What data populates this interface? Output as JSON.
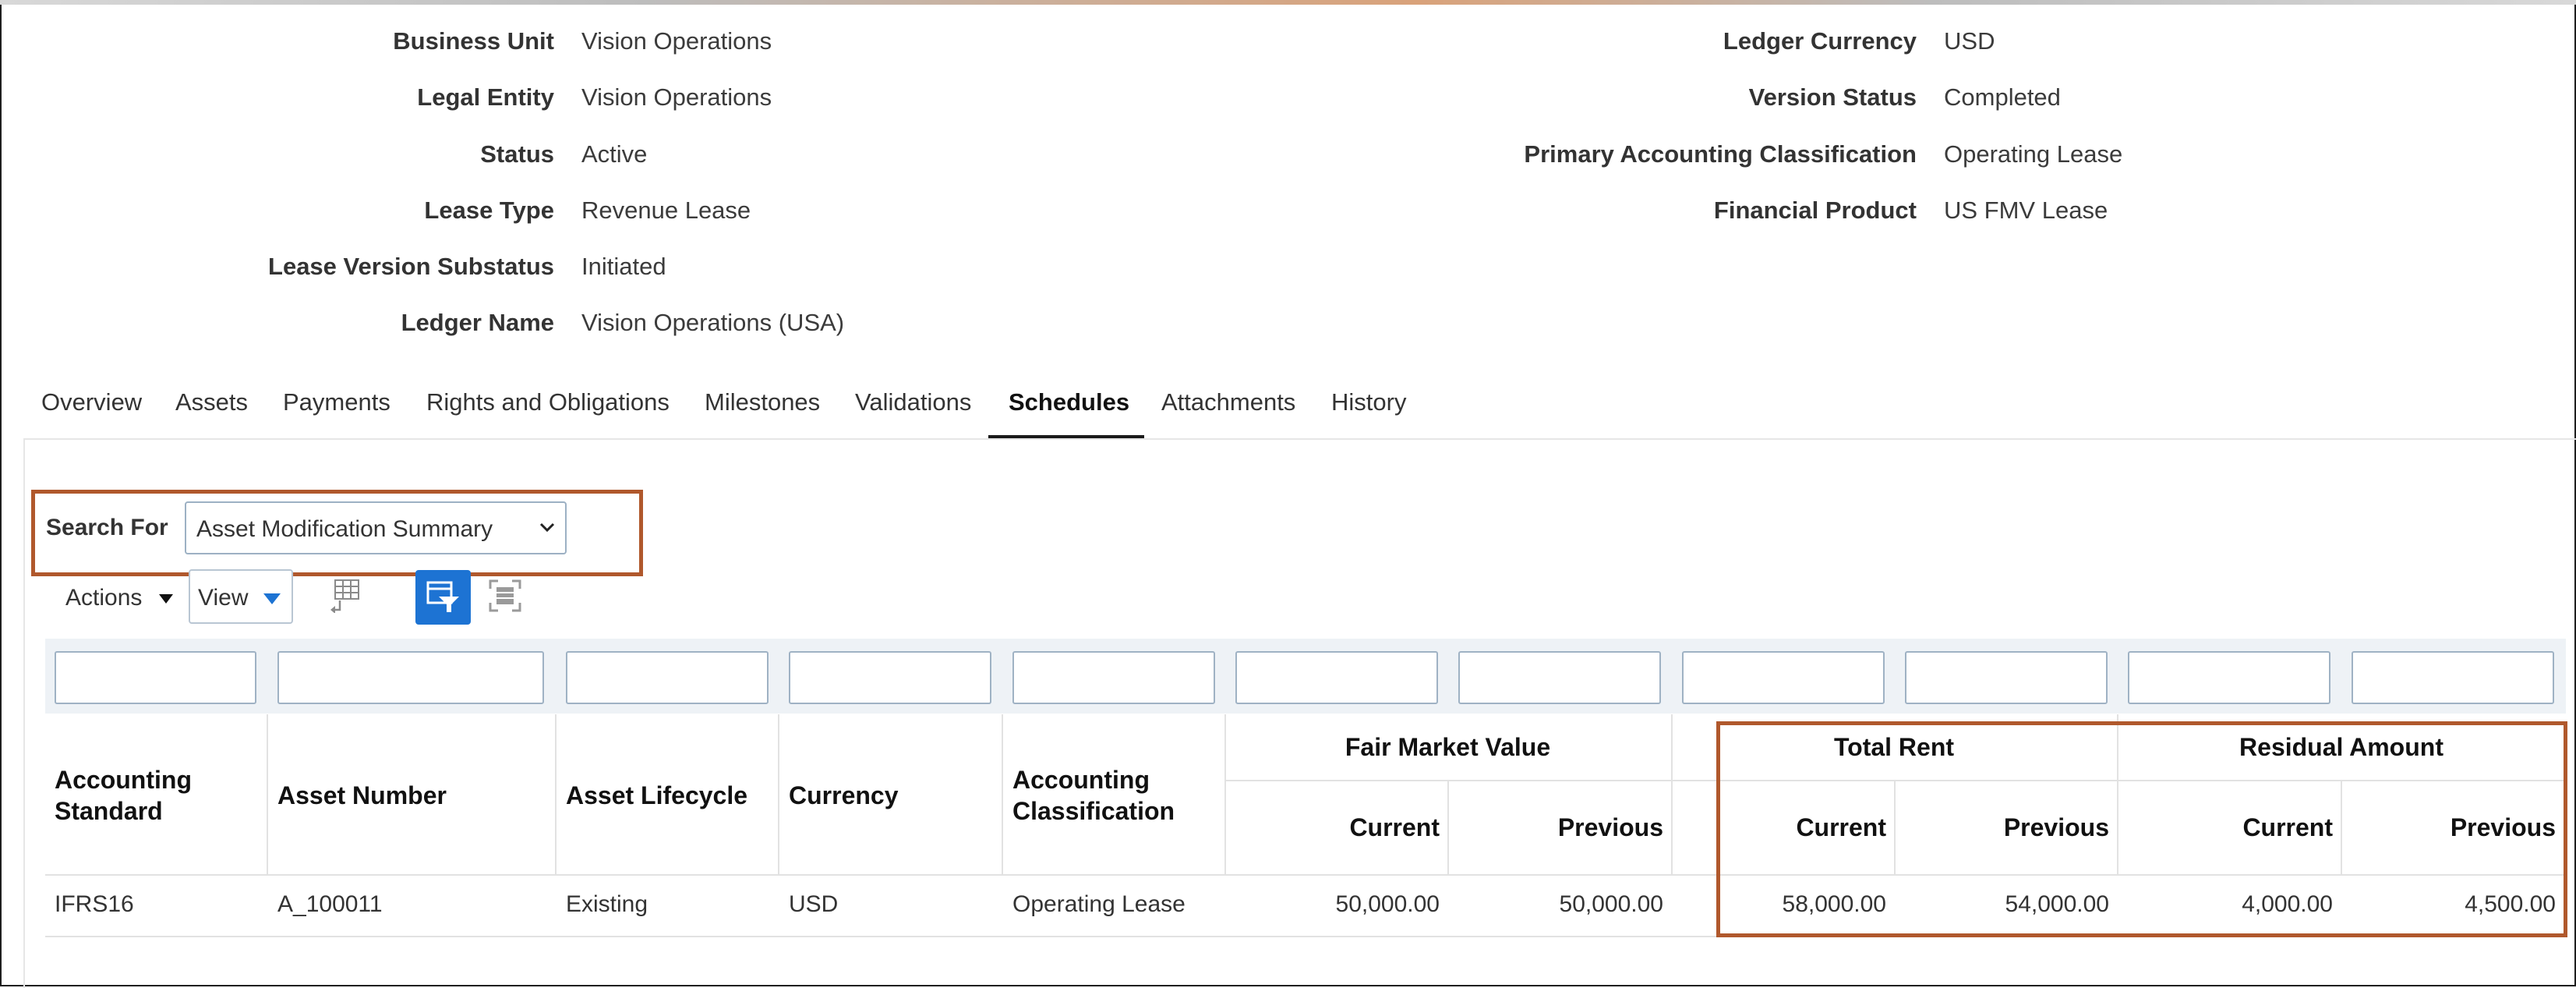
{
  "header": {
    "left": [
      {
        "label": "Business Unit",
        "value": "Vision Operations"
      },
      {
        "label": "Legal Entity",
        "value": "Vision Operations"
      },
      {
        "label": "Status",
        "value": "Active"
      },
      {
        "label": "Lease Type",
        "value": "Revenue Lease"
      },
      {
        "label": "Lease Version Substatus",
        "value": "Initiated"
      },
      {
        "label": "Ledger Name",
        "value": "Vision Operations (USA)"
      }
    ],
    "right": [
      {
        "label": "Ledger Currency",
        "value": "USD"
      },
      {
        "label": "Version Status",
        "value": "Completed"
      },
      {
        "label": "Primary Accounting Classification",
        "value": "Operating Lease"
      },
      {
        "label": "Financial Product",
        "value": "US FMV Lease"
      }
    ]
  },
  "tabs": [
    "Overview",
    "Assets",
    "Payments",
    "Rights and Obligations",
    "Milestones",
    "Validations",
    "Schedules",
    "Attachments",
    "History"
  ],
  "active_tab": "Schedules",
  "search": {
    "label": "Search For",
    "selected": "Asset Modification Summary"
  },
  "toolbar": {
    "actions_label": "Actions",
    "view_label": "View"
  },
  "table": {
    "columns": {
      "accounting_standard": "Accounting Standard",
      "asset_number": "Asset Number",
      "asset_lifecycle": "Asset Lifecycle",
      "currency": "Currency",
      "accounting_classification": "Accounting Classification",
      "fmv_group": "Fair Market Value",
      "total_rent_group": "Total Rent",
      "residual_group": "Residual Amount",
      "current": "Current",
      "previous": "Previous"
    },
    "rows": [
      {
        "accounting_standard": "IFRS16",
        "asset_number": "A_100011",
        "asset_lifecycle": "Existing",
        "currency": "USD",
        "accounting_classification": "Operating Lease",
        "fmv_current": "50,000.00",
        "fmv_previous": "50,000.00",
        "rent_current": "58,000.00",
        "rent_previous": "54,000.00",
        "residual_current": "4,000.00",
        "residual_previous": "4,500.00"
      }
    ]
  },
  "colors": {
    "highlight": "#b0582c",
    "filter_button": "#1d73d3"
  }
}
